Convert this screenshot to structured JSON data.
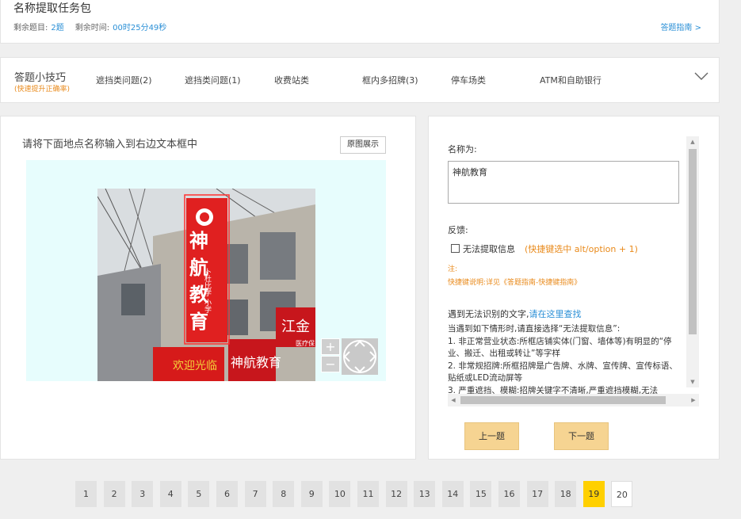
{
  "header": {
    "title": "名称提取任务包",
    "remaining_label": "剩余题目:",
    "remaining_value": "2题",
    "time_label": "剩余时间:",
    "time_value": "00时25分49秒",
    "guide_link": "答题指南 >"
  },
  "tips": {
    "title": "答题小技巧",
    "subtitle": "(快速提升正确率)",
    "tabs": [
      {
        "label": "遮挡类问题(2)"
      },
      {
        "label": "遮挡类问题(1)"
      },
      {
        "label": "收费站类"
      },
      {
        "label": "框内多招牌(3)"
      },
      {
        "label": "停车场类"
      },
      {
        "label": "ATM和自助银行"
      }
    ],
    "expand_icon": "chevron-down-icon"
  },
  "left_panel": {
    "instruction": "请将下面地点名称输入到右边文本框中",
    "original_button": "原图展示",
    "photo": {
      "sign_text": "神航教育",
      "sign_small": "卜杜比学 小学",
      "side_sign_1": "江金",
      "side_sign_2": "医疗保",
      "lower_sign": "神航教育",
      "lower_left_sign": "欢迎光临"
    },
    "zoom_in": "+",
    "zoom_out": "−"
  },
  "right_panel": {
    "name_label": "名称为:",
    "name_value": "神航教育",
    "feedback_label": "反馈:",
    "unable_label": "无法提取信息",
    "unable_hint": "(快捷键选中 alt/option + 1)",
    "note_label": "注:",
    "shortcut_note": "快捷键说明:详见《答题指南-快捷键指南》",
    "unknown_text_prefix": "遇到无法识别的文字,",
    "unknown_text_link": "请在这里查找",
    "para_lines": [
      "当遇到如下情形时,请直接选择“无法提取信息”:",
      "1. 非正常营业状态:所框店铺实体(门窗、墙体等)有明显的“停业、搬迁、出租或转让”等字样",
      "2. 非常规招牌:所框招牌是广告牌、水牌、宣传牌、宣传标语、贴纸或LED流动屏等",
      "3. 严重遮挡、模糊:招牌关键字不清晰,严重遮挡模糊,无法"
    ],
    "prev_button": "上一题",
    "next_button": "下一题"
  },
  "pagination": {
    "pages": [
      "1",
      "2",
      "3",
      "4",
      "5",
      "6",
      "7",
      "8",
      "9",
      "10",
      "11",
      "12",
      "13",
      "14",
      "15",
      "16",
      "17",
      "18",
      "19",
      "20"
    ],
    "current": "19"
  },
  "colors": {
    "accent_blue": "#2a8fd6",
    "accent_orange": "#e98a1b",
    "current_page": "#ffd000",
    "nav_button": "#f6d492"
  }
}
